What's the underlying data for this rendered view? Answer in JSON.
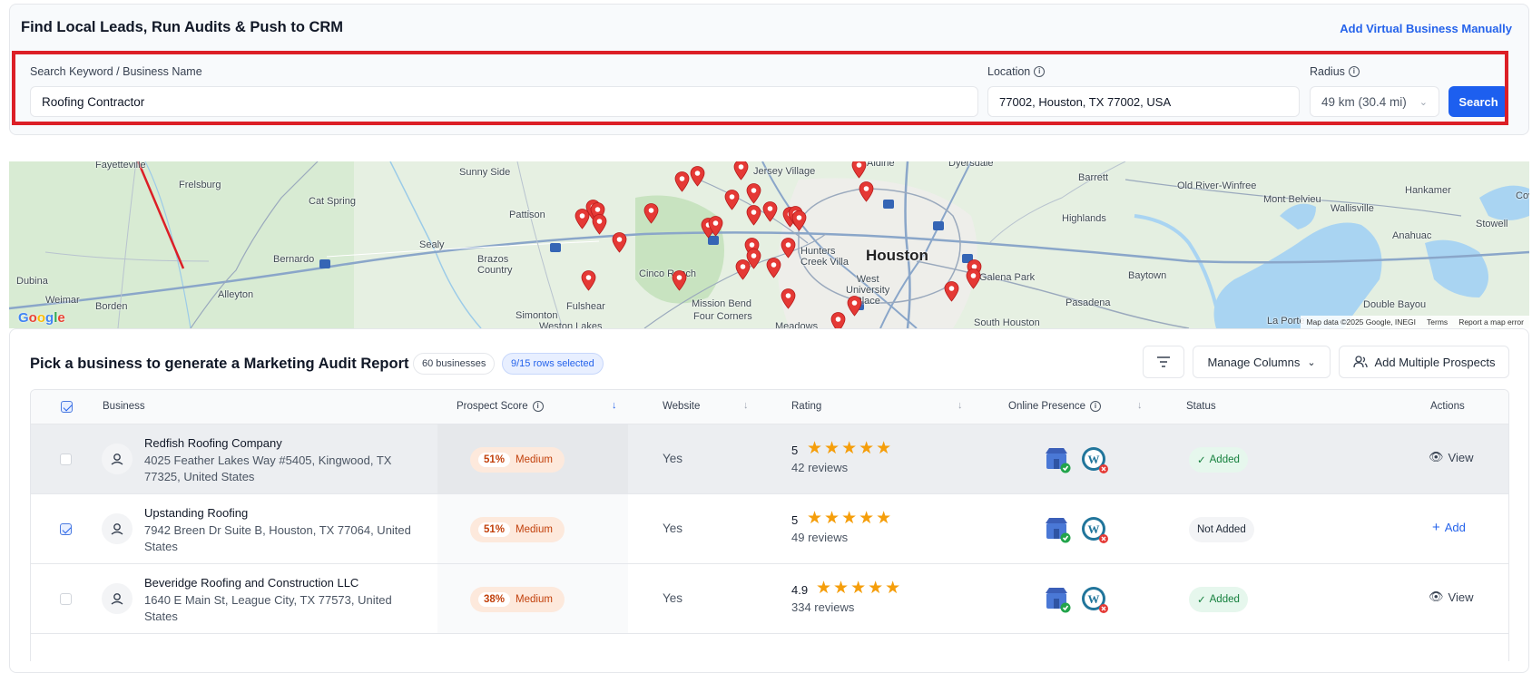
{
  "header": {
    "title": "Find Local Leads, Run Audits & Push to CRM",
    "add_virtual_label": "Add Virtual Business Manually"
  },
  "search": {
    "keyword_label": "Search Keyword / Business Name",
    "keyword_value": "Roofing Contractor",
    "location_label": "Location",
    "location_value": "77002, Houston, TX 77002, USA",
    "radius_label": "Radius",
    "radius_value": "49 km (30.4 mi)",
    "search_button": "Search"
  },
  "map": {
    "labels": [
      "Fayetteville",
      "Frelsburg",
      "Sunny Side",
      "Cat Spring",
      "Pattison",
      "Sealy",
      "Bernardo",
      "Brazos Country",
      "Cinco Ranch",
      "Dubina",
      "Weimar",
      "Borden",
      "Alleyton",
      "Simonton",
      "Fulshear",
      "Weston Lakes",
      "Mission Bend",
      "Four Corners",
      "Jersey Village",
      "Aldine",
      "Dyersdale",
      "Barrett",
      "Old River-Winfree",
      "Hankamer",
      "Mont Belvieu",
      "Cove",
      "Wallisville",
      "Highlands",
      "Stowell",
      "Anahuac",
      "Hunters Creek Village",
      "Houston",
      "West University Place",
      "Galena Park",
      "Baytown",
      "Pasadena",
      "South Houston",
      "Meadows",
      "Double Bayou",
      "La Porte"
    ],
    "google": "Google",
    "attribution": [
      "Map data ©2025 Google, INEGI",
      "Terms",
      "Report a map error"
    ]
  },
  "list": {
    "title": "Pick a business to generate a Marketing Audit Report",
    "count_badge": "60 businesses",
    "selected_badge": "9/15 rows selected",
    "manage_columns": "Manage Columns",
    "add_multiple": "Add Multiple Prospects",
    "columns": [
      "Business",
      "Prospect Score",
      "Website",
      "Rating",
      "Online Presence",
      "Status",
      "Actions"
    ],
    "rows": [
      {
        "name": "Redfish Roofing Company",
        "address": "4025 Feather Lakes Way #5405, Kingwood, TX 77325, United States",
        "score": "51%",
        "level": "Medium",
        "website": "Yes",
        "rating": "5",
        "rating_value": 5,
        "reviews": "42 reviews",
        "status": "Added",
        "action": "View",
        "checked": false
      },
      {
        "name": "Upstanding Roofing",
        "address": "7942 Breen Dr Suite B, Houston, TX 77064, United States",
        "score": "51%",
        "level": "Medium",
        "website": "Yes",
        "rating": "5",
        "rating_value": 5,
        "reviews": "49 reviews",
        "status": "Not Added",
        "action": "Add",
        "checked": true
      },
      {
        "name": "Beveridge Roofing and Construction LLC",
        "address": "1640 E Main St, League City, TX 77573, United States",
        "score": "38%",
        "level": "Medium",
        "website": "Yes",
        "rating": "4.9",
        "rating_value": 4.9,
        "reviews": "334 reviews",
        "status": "Added",
        "action": "View",
        "checked": false
      }
    ]
  },
  "colors": {
    "accent": "#1d5fef",
    "highlight": "#dc1f26",
    "star": "#f59e0b",
    "pin": "#e53935"
  }
}
